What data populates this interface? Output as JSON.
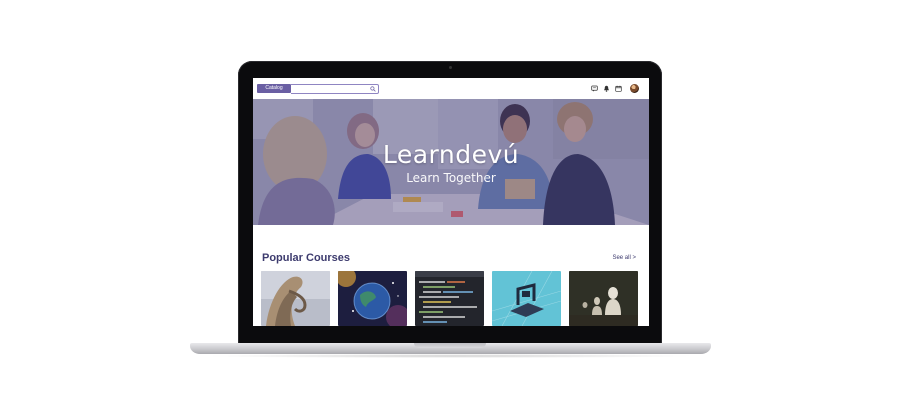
{
  "navbar": {
    "catalog_label": "Catalog",
    "search_placeholder": "",
    "icons": [
      "chat-icon",
      "bell-icon",
      "calendar-icon",
      "avatar"
    ]
  },
  "hero": {
    "title": "Learndevú",
    "subtitle": "Learn Together"
  },
  "popular": {
    "title": "Popular Courses",
    "see_all": "See all >",
    "courses": [
      {
        "thumb": "architecture"
      },
      {
        "thumb": "earth-in-space"
      },
      {
        "thumb": "code-editor"
      },
      {
        "thumb": "3d-printer"
      },
      {
        "thumb": "busts-gallery"
      }
    ]
  },
  "colors": {
    "accent": "#6a5fa3",
    "heading": "#3d3b6e",
    "hero_overlay": "#463a78"
  }
}
